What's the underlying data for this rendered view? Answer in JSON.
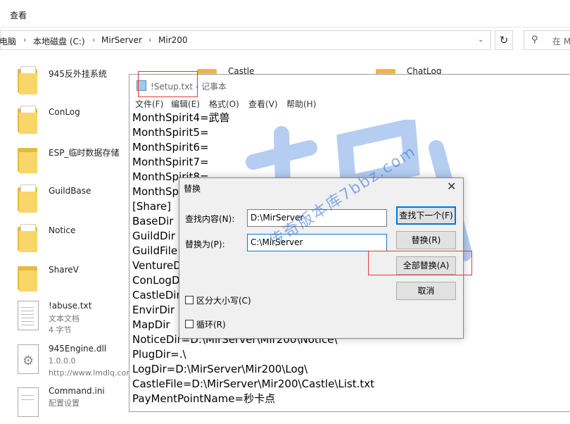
{
  "ribbon": {
    "tab_view": "查看"
  },
  "address": {
    "crumbs": [
      "电脑",
      "本地磁盘 (C:)",
      "MirServer",
      "Mir200"
    ]
  },
  "search": {
    "placeholder": "在 M"
  },
  "files": [
    {
      "name": "945反外挂系统",
      "type": "folder"
    },
    {
      "name": "ConLog",
      "type": "folder"
    },
    {
      "name": "ESP_临时数据存储",
      "type": "folder"
    },
    {
      "name": "GuildBase",
      "type": "folder"
    },
    {
      "name": "Notice",
      "type": "folder"
    },
    {
      "name": "ShareV",
      "type": "folder"
    },
    {
      "name": "!abuse.txt",
      "line2": "文本文档",
      "line3": "4 字节"
    },
    {
      "name": "945Engine.dll",
      "line2": "1.0.0.0",
      "line3": "http://www.lmdlq.com"
    },
    {
      "name": "Command.ini",
      "line2": "配置设置"
    }
  ],
  "files_col2": [
    {
      "name": "Castle"
    },
    {
      "name": "ChatLog"
    }
  ],
  "notepad": {
    "title": "!Setup.txt - 记事本",
    "menu": [
      "文件(F)",
      "编辑(E)",
      "格式(O)",
      "查看(V)",
      "帮助(H)"
    ],
    "lines": [
      "MonthSpirit4=武兽",
      "MonthSpirit5=",
      "MonthSpirit6=",
      "MonthSpirit7=",
      "MonthSpirit8=",
      "MonthSp",
      "[Share]",
      "BaseDir",
      "GuildDir",
      "GuildFile",
      "VentureD",
      "ConLogD",
      "CastleDir",
      "EnvirDir",
      "MapDir",
      "NoticeDir=D:\\MirServer\\Mir200\\Notice\\",
      "PlugDir=.\\",
      "LogDir=D:\\MirServer\\Mir200\\Log\\",
      "CastleFile=D:\\MirServer\\Mir200\\Castle\\List.txt",
      "PayMentPointName=秒卡点"
    ]
  },
  "replace_dialog": {
    "title": "替换",
    "find_label": "查找内容(N):",
    "find_value": "D:\\MirServer",
    "replace_label": "替换为(P):",
    "replace_value": "C:\\MirServer",
    "find_next": "查找下一个(F)",
    "replace": "替换(R)",
    "replace_all": "全部替换(A)",
    "cancel": "取消",
    "match_case": "区分大小写(C)",
    "wrap": "循环(R)"
  },
  "watermark": {
    "text": "传奇版本库7bbz.com"
  },
  "colors": {
    "accent": "#0078d7",
    "highlight_box": "#e53935",
    "watermark": "#2f72d8",
    "folder": "#f9d66a"
  }
}
